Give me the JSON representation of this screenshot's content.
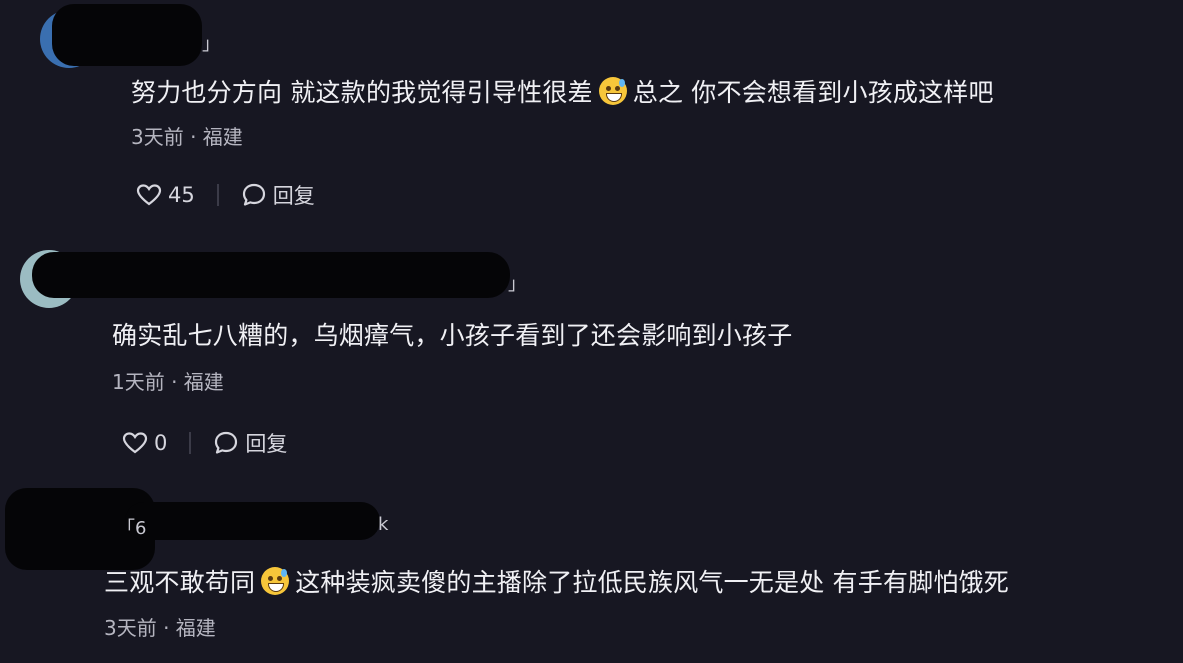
{
  "comments": [
    {
      "name_tail": "」",
      "text_before": "努力也分方向 就这款的我觉得引导性很差",
      "text_after": "总之 你不会想看到小孩成这样吧",
      "emoji": "grinning-sweat-emoji",
      "meta": "3天前 · 福建",
      "likes": "45",
      "reply_label": "回复"
    },
    {
      "name_tail": "」",
      "text_before": "确实乱七八糟的，乌烟瘴气，小孩子看到了还会影响到小孩子",
      "meta": "1天前 · 福建",
      "likes": "0",
      "reply_label": "回复"
    },
    {
      "name_tail": "「6",
      "name_tail2": "k",
      "text_before": "三观不敢苟同",
      "text_after": "这种装疯卖傻的主播除了拉低民族风气一无是处 有手有脚怕饿死",
      "emoji": "grinning-sweat-emoji",
      "meta": "3天前 · 福建"
    }
  ],
  "colors": {
    "background": "#171722",
    "redaction": "#050507"
  }
}
